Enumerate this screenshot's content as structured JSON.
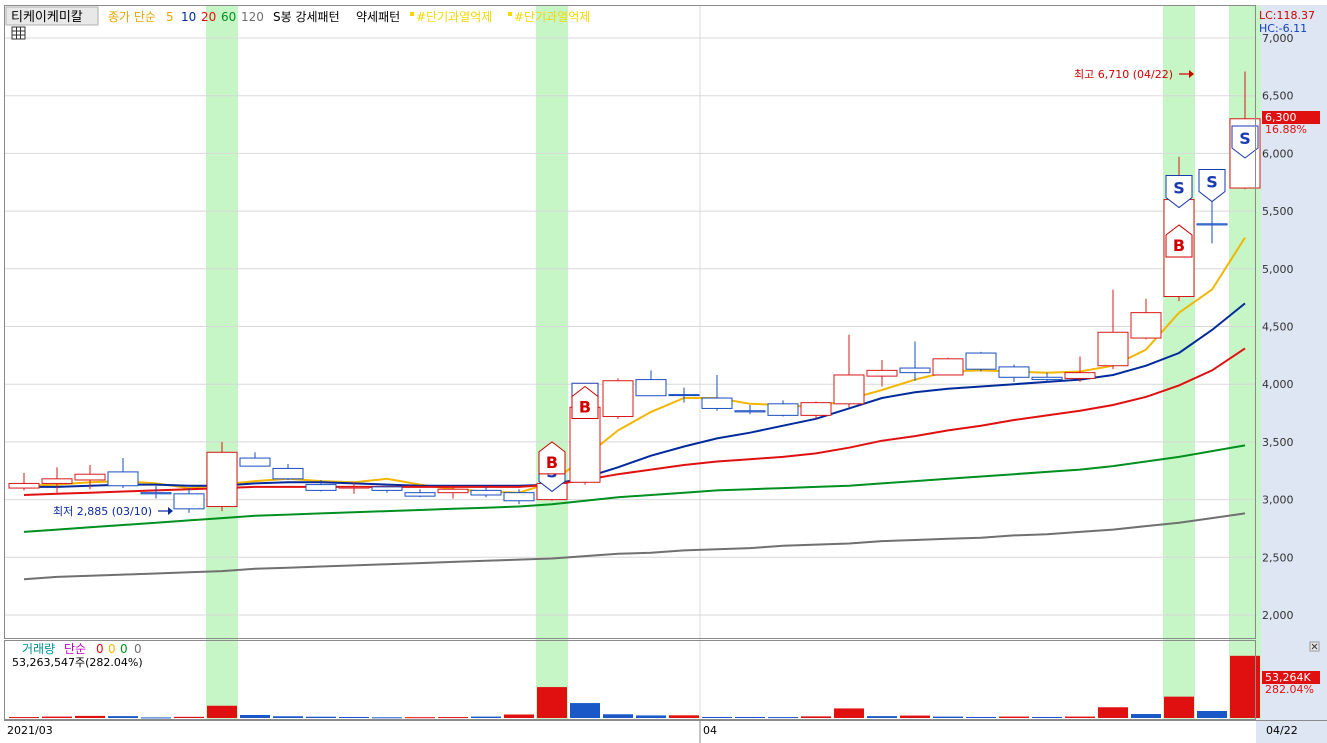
{
  "header": {
    "stock_name": "티케이케미칼",
    "ma_label": "종가 단순",
    "ma_periods": [
      "5",
      "10",
      "20",
      "60",
      "120"
    ],
    "ma_colors": [
      "#f2b600",
      "#002a9c",
      "#e01010",
      "#009020",
      "#707070"
    ],
    "sbong_label": "S봉 강세패턴",
    "weak_pattern_label": "약세패턴",
    "cond1_label": "#단기과열억제",
    "cond2_label": "#단기과열억제"
  },
  "corner": {
    "lc_text": "LC:118.37",
    "hc_text": "HC:-6.11"
  },
  "price_panel": {
    "current_price": "6,300",
    "current_change": "16.88%",
    "high_label": "최고 6,710 (04/22)",
    "low_label": "최저 2,885 (03/10)"
  },
  "volume_panel": {
    "title": "거래량",
    "ma_label": "단순",
    "ma_values": [
      "0",
      "0",
      "0",
      "0"
    ],
    "volume_text": "53,263,547주(282.04%)",
    "current_volume": "53,264K",
    "current_pct": "282.04%"
  },
  "footer": {
    "start_date": "2021/03",
    "month_mark": "04",
    "end_date": "04/22"
  },
  "chart_data": {
    "type": "candlestick",
    "y_ticks": [
      2000,
      2500,
      3000,
      3500,
      4000,
      4500,
      5000,
      5500,
      6000,
      6500,
      7000
    ],
    "y_tick_labels": [
      "2,000",
      "2,500",
      "3,000",
      "3,500",
      "4,000",
      "4,500",
      "5,000",
      "5,500",
      "6,000",
      "6,500",
      "7,000"
    ],
    "ylim": [
      1800,
      7100
    ],
    "candles": [
      {
        "o": 3100,
        "h": 3230,
        "l": 3080,
        "c": 3140,
        "up": true
      },
      {
        "o": 3140,
        "h": 3280,
        "l": 3060,
        "c": 3180,
        "up": true
      },
      {
        "o": 3170,
        "h": 3300,
        "l": 3090,
        "c": 3220,
        "up": true
      },
      {
        "o": 3240,
        "h": 3360,
        "l": 3100,
        "c": 3120,
        "up": false
      },
      {
        "o": 3060,
        "h": 3120,
        "l": 3010,
        "c": 3050,
        "up": false
      },
      {
        "o": 3050,
        "h": 3100,
        "l": 2885,
        "c": 2920,
        "up": false
      },
      {
        "o": 2940,
        "h": 3500,
        "l": 2900,
        "c": 3410,
        "up": true
      },
      {
        "o": 3360,
        "h": 3410,
        "l": 3300,
        "c": 3290,
        "up": false
      },
      {
        "o": 3270,
        "h": 3310,
        "l": 3170,
        "c": 3180,
        "up": false
      },
      {
        "o": 3130,
        "h": 3170,
        "l": 3070,
        "c": 3080,
        "up": false
      },
      {
        "o": 3100,
        "h": 3150,
        "l": 3050,
        "c": 3110,
        "up": true
      },
      {
        "o": 3110,
        "h": 3140,
        "l": 3060,
        "c": 3080,
        "up": false
      },
      {
        "o": 3060,
        "h": 3090,
        "l": 3020,
        "c": 3030,
        "up": false
      },
      {
        "o": 3060,
        "h": 3110,
        "l": 3010,
        "c": 3090,
        "up": true
      },
      {
        "o": 3080,
        "h": 3110,
        "l": 3020,
        "c": 3040,
        "up": false
      },
      {
        "o": 3060,
        "h": 3090,
        "l": 2960,
        "c": 2990,
        "up": false
      },
      {
        "o": 3000,
        "h": 3280,
        "l": 2990,
        "c": 3140,
        "up": true
      },
      {
        "o": 3150,
        "h": 3880,
        "l": 3130,
        "c": 3800,
        "up": true
      },
      {
        "o": 3720,
        "h": 4050,
        "l": 3700,
        "c": 4030,
        "up": true
      },
      {
        "o": 4040,
        "h": 4120,
        "l": 3900,
        "c": 3900,
        "up": false
      },
      {
        "o": 3910,
        "h": 3970,
        "l": 3840,
        "c": 3910,
        "up": false
      },
      {
        "o": 3880,
        "h": 4080,
        "l": 3770,
        "c": 3790,
        "up": false
      },
      {
        "o": 3770,
        "h": 3820,
        "l": 3740,
        "c": 3760,
        "up": false
      },
      {
        "o": 3830,
        "h": 3860,
        "l": 3720,
        "c": 3730,
        "up": false
      },
      {
        "o": 3730,
        "h": 3850,
        "l": 3700,
        "c": 3840,
        "up": true
      },
      {
        "o": 3830,
        "h": 4430,
        "l": 3800,
        "c": 4080,
        "up": true
      },
      {
        "o": 4070,
        "h": 4210,
        "l": 3980,
        "c": 4120,
        "up": true
      },
      {
        "o": 4100,
        "h": 4370,
        "l": 4030,
        "c": 4140,
        "up": false
      },
      {
        "o": 4080,
        "h": 4230,
        "l": 4080,
        "c": 4220,
        "up": true
      },
      {
        "o": 4270,
        "h": 4280,
        "l": 4110,
        "c": 4130,
        "up": false
      },
      {
        "o": 4150,
        "h": 4170,
        "l": 4020,
        "c": 4060,
        "up": false
      },
      {
        "o": 4060,
        "h": 4100,
        "l": 4010,
        "c": 4040,
        "up": false
      },
      {
        "o": 4050,
        "h": 4240,
        "l": 4020,
        "c": 4100,
        "up": true
      },
      {
        "o": 4160,
        "h": 4820,
        "l": 4130,
        "c": 4450,
        "up": true
      },
      {
        "o": 4400,
        "h": 4740,
        "l": 4390,
        "c": 4620,
        "up": true
      },
      {
        "o": 4760,
        "h": 5970,
        "l": 4720,
        "c": 5600,
        "up": true
      },
      {
        "o": 5390,
        "h": 5600,
        "l": 5220,
        "c": 5380,
        "up": false
      },
      {
        "o": 5700,
        "h": 6710,
        "l": 5690,
        "c": 6300,
        "up": true
      }
    ],
    "ma_series": [
      {
        "period": "5",
        "values": [
          3120,
          3130,
          3150,
          3160,
          3140,
          3100,
          3130,
          3160,
          3180,
          3160,
          3150,
          3180,
          3130,
          3090,
          3070,
          3060,
          3150,
          3370,
          3600,
          3760,
          3880,
          3880,
          3830,
          3820,
          3800,
          3870,
          3950,
          4040,
          4110,
          4120,
          4110,
          4100,
          4110,
          4160,
          4300,
          4620,
          4820,
          5270
        ]
      },
      {
        "period": "10",
        "values": [
          3110,
          3110,
          3120,
          3130,
          3130,
          3120,
          3120,
          3140,
          3150,
          3150,
          3140,
          3130,
          3120,
          3120,
          3120,
          3120,
          3130,
          3190,
          3280,
          3380,
          3460,
          3530,
          3580,
          3640,
          3700,
          3790,
          3880,
          3930,
          3960,
          3980,
          4000,
          4020,
          4040,
          4080,
          4160,
          4270,
          4470,
          4700
        ]
      },
      {
        "period": "20",
        "values": [
          3040,
          3050,
          3060,
          3070,
          3080,
          3090,
          3100,
          3110,
          3110,
          3110,
          3110,
          3110,
          3110,
          3110,
          3110,
          3110,
          3130,
          3170,
          3220,
          3260,
          3300,
          3330,
          3350,
          3370,
          3400,
          3450,
          3510,
          3550,
          3600,
          3640,
          3690,
          3730,
          3770,
          3820,
          3890,
          3990,
          4120,
          4310
        ]
      },
      {
        "period": "60",
        "values": [
          2720,
          2740,
          2760,
          2780,
          2800,
          2820,
          2840,
          2860,
          2870,
          2880,
          2890,
          2900,
          2910,
          2920,
          2930,
          2940,
          2960,
          2990,
          3020,
          3040,
          3060,
          3080,
          3090,
          3100,
          3110,
          3120,
          3140,
          3160,
          3180,
          3200,
          3220,
          3240,
          3260,
          3290,
          3330,
          3370,
          3420,
          3470
        ]
      },
      {
        "period": "120",
        "values": [
          2310,
          2330,
          2340,
          2350,
          2360,
          2370,
          2380,
          2400,
          2410,
          2420,
          2430,
          2440,
          2450,
          2460,
          2470,
          2480,
          2490,
          2510,
          2530,
          2540,
          2560,
          2570,
          2580,
          2600,
          2610,
          2620,
          2640,
          2650,
          2660,
          2670,
          2690,
          2700,
          2720,
          2740,
          2770,
          2800,
          2840,
          2880
        ]
      }
    ],
    "volumes": [
      0.8,
      1.2,
      1.8,
      1.6,
      0.5,
      1.0,
      10.5,
      2.6,
      1.5,
      1.1,
      0.9,
      0.6,
      0.7,
      0.8,
      1.2,
      3.0,
      26.5,
      12.8,
      3.2,
      2.2,
      2.3,
      0.9,
      0.9,
      0.8,
      1.4,
      8.2,
      1.6,
      2.1,
      1.2,
      0.9,
      1.2,
      0.9,
      1.2,
      9.2,
      3.4,
      18.3,
      6.0,
      53.3
    ],
    "vol_up": [
      true,
      true,
      true,
      false,
      false,
      true,
      true,
      false,
      false,
      false,
      false,
      false,
      true,
      true,
      false,
      true,
      true,
      false,
      false,
      false,
      true,
      false,
      false,
      false,
      true,
      true,
      false,
      true,
      false,
      false,
      true,
      false,
      true,
      true,
      false,
      true,
      false,
      true
    ],
    "vol_ylim": [
      0,
      60
    ],
    "highlight_indices": [
      6,
      16,
      35,
      37
    ],
    "buy_signals": [
      16,
      17,
      35
    ],
    "sell_signals": [
      16,
      17,
      35,
      36,
      37
    ]
  }
}
